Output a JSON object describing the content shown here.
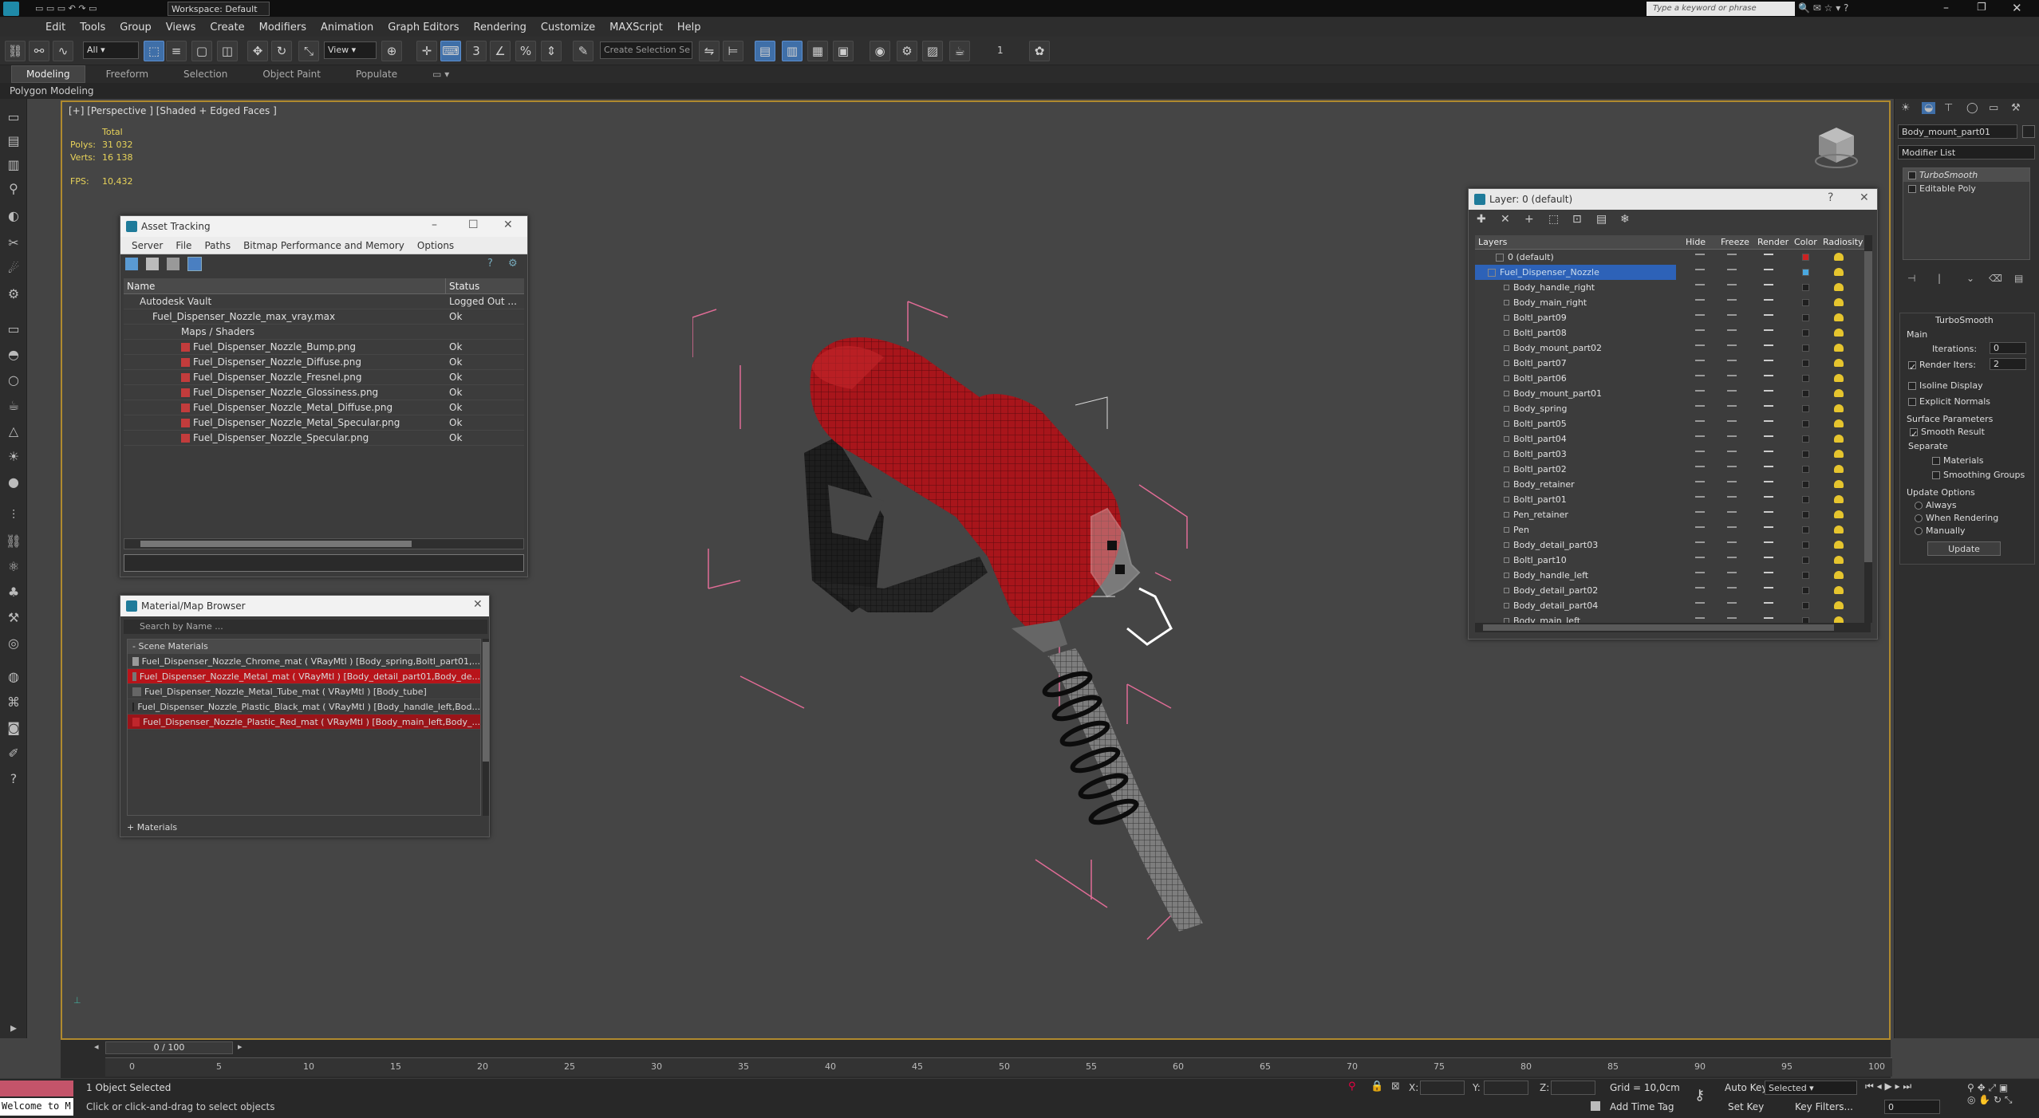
{
  "title_bar": {
    "workspace": "Workspace: Default",
    "search_placeholder": "Type a keyword or phrase"
  },
  "menu": [
    "Edit",
    "Tools",
    "Group",
    "Views",
    "Create",
    "Modifiers",
    "Animation",
    "Graph Editors",
    "Rendering",
    "Customize",
    "MAXScript",
    "Help"
  ],
  "toolbar": {
    "selection_filter": "All",
    "coord_system": "View",
    "selection_set_placeholder": "Create Selection Se",
    "snap_value": "1"
  },
  "ribbon": {
    "tabs": [
      "Modeling",
      "Freeform",
      "Selection",
      "Object Paint",
      "Populate"
    ],
    "subbar": "Polygon Modeling"
  },
  "viewport": {
    "label": "[+] [Perspective ] [Shaded + Edged Faces ]",
    "stats": {
      "header": "Total",
      "polys_label": "Polys:",
      "polys": "31 032",
      "verts_label": "Verts:",
      "verts": "16 138",
      "fps_label": "FPS:",
      "fps": "10,432"
    }
  },
  "asset_tracking": {
    "title": "Asset Tracking",
    "menu": [
      "Server",
      "File",
      "Paths",
      "Bitmap Performance and Memory",
      "Options"
    ],
    "columns": [
      "Name",
      "Status"
    ],
    "rows": [
      {
        "name": "Autodesk Vault",
        "status": "Logged Out ..."
      },
      {
        "name": "Fuel_Dispenser_Nozzle_max_vray.max",
        "status": "Ok"
      },
      {
        "name": "Maps / Shaders",
        "status": ""
      },
      {
        "name": "Fuel_Dispenser_Nozzle_Bump.png",
        "status": "Ok"
      },
      {
        "name": "Fuel_Dispenser_Nozzle_Diffuse.png",
        "status": "Ok"
      },
      {
        "name": "Fuel_Dispenser_Nozzle_Fresnel.png",
        "status": "Ok"
      },
      {
        "name": "Fuel_Dispenser_Nozzle_Glossiness.png",
        "status": "Ok"
      },
      {
        "name": "Fuel_Dispenser_Nozzle_Metal_Diffuse.png",
        "status": "Ok"
      },
      {
        "name": "Fuel_Dispenser_Nozzle_Metal_Specular.png",
        "status": "Ok"
      },
      {
        "name": "Fuel_Dispenser_Nozzle_Specular.png",
        "status": "Ok"
      }
    ]
  },
  "material_browser": {
    "title": "Material/Map Browser",
    "search_placeholder": "Search by Name ...",
    "section": "- Scene Materials",
    "items": [
      "Fuel_Dispenser_Nozzle_Chrome_mat ( VRayMtl ) [Body_spring,Boltl_part01,...",
      "Fuel_Dispenser_Nozzle_Metal_mat ( VRayMtl ) [Body_detail_part01,Body_de...",
      "Fuel_Dispenser_Nozzle_Metal_Tube_mat ( VRayMtl ) [Body_tube]",
      "Fuel_Dispenser_Nozzle_Plastic_Black_mat ( VRayMtl ) [Body_handle_left,Bod...",
      "Fuel_Dispenser_Nozzle_Plastic_Red_mat ( VRayMtl ) [Body_main_left,Body_..."
    ],
    "footer": "+ Materials"
  },
  "layer_explorer": {
    "title": "Layer: 0 (default)",
    "columns": [
      "Layers",
      "Hide",
      "Freeze",
      "Render",
      "Color",
      "Radiosity"
    ],
    "layers": [
      "0 (default)",
      "Fuel_Dispenser_Nozzle"
    ],
    "objects": [
      "Body_handle_right",
      "Body_main_right",
      "Boltl_part09",
      "Boltl_part08",
      "Body_mount_part02",
      "Boltl_part07",
      "Boltl_part06",
      "Body_mount_part01",
      "Body_spring",
      "Boltl_part05",
      "Boltl_part04",
      "Boltl_part03",
      "Boltl_part02",
      "Body_retainer",
      "Boltl_part01",
      "Pen_retainer",
      "Pen",
      "Body_detail_part03",
      "Boltl_part10",
      "Body_handle_left",
      "Body_detail_part02",
      "Body_detail_part04",
      "Body_main_left"
    ]
  },
  "command_panel": {
    "object_name": "Body_mount_part01",
    "modifier_list": "Modifier List",
    "stack": [
      "TurboSmooth",
      "Editable Poly"
    ],
    "rollout_title": "TurboSmooth",
    "main_label": "Main",
    "iterations_label": "Iterations:",
    "iterations": "0",
    "render_iters_label": "Render Iters:",
    "render_iters": "2",
    "isoline": "Isoline Display",
    "explicit": "Explicit Normals",
    "surface_params": "Surface Parameters",
    "smooth_result": "Smooth Result",
    "separate": "Separate",
    "materials": "Materials",
    "smoothing_groups": "Smoothing Groups",
    "update_options": "Update Options",
    "always": "Always",
    "when_rendering": "When Rendering",
    "manually": "Manually",
    "update_btn": "Update"
  },
  "timeline": {
    "frame": "0 / 100",
    "ticks": [
      "0",
      "5",
      "10",
      "15",
      "20",
      "25",
      "30",
      "35",
      "40",
      "45",
      "50",
      "55",
      "60",
      "65",
      "70",
      "75",
      "80",
      "85",
      "90",
      "95",
      "100"
    ]
  },
  "status": {
    "maxscript": "Welcome to M",
    "selected": "1 Object Selected",
    "prompt": "Click or click-and-drag to select objects",
    "x_label": "X:",
    "y_label": "Y:",
    "z_label": "Z:",
    "grid": "Grid = 10,0cm",
    "add_time_tag": "Add Time Tag",
    "auto_key": "Auto Key",
    "selected_dd": "Selected",
    "set_key": "Set Key",
    "key_filters": "Key Filters...",
    "frame_value": "0"
  },
  "colors": {
    "accent": "#3f6fa8",
    "viewport_border": "#b08a2e",
    "nozzle_red": "#b8141a",
    "stats_yellow": "#e8d35a"
  }
}
